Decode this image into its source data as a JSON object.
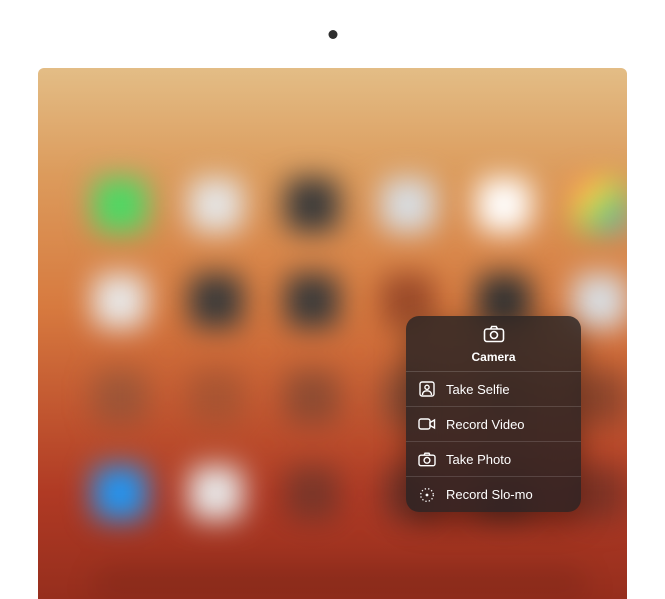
{
  "menu": {
    "title": "Camera",
    "items": [
      {
        "label": "Take Selfie",
        "icon": "person-square"
      },
      {
        "label": "Record Video",
        "icon": "video"
      },
      {
        "label": "Take Photo",
        "icon": "camera"
      },
      {
        "label": "Record Slo-mo",
        "icon": "dial"
      }
    ]
  }
}
